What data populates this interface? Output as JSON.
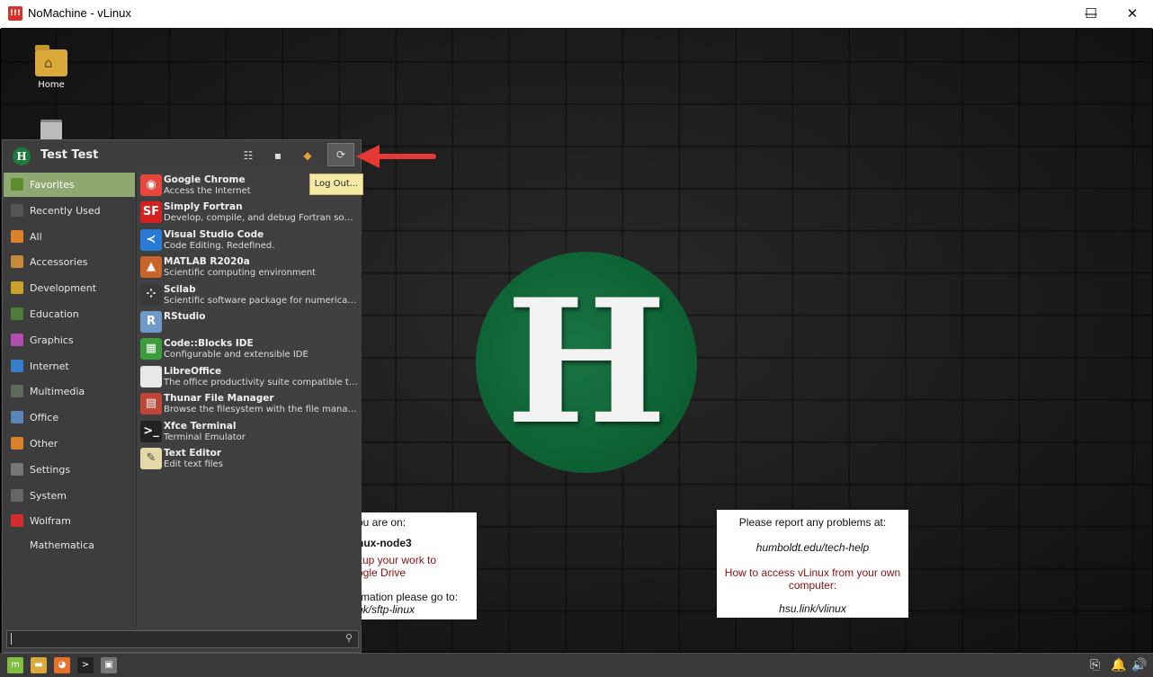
{
  "window": {
    "title": "NoMachine - vLinux",
    "minimize_glyph": "—",
    "maximize_glyph": "☐",
    "close_glyph": "✕"
  },
  "desktop": {
    "icons": [
      {
        "label": "Home",
        "icon": "home-folder-icon"
      },
      {
        "label": "",
        "icon": "trash-icon"
      }
    ],
    "logo_letter": "H",
    "left_info": {
      "line1": "ou are on:",
      "line2": "nux-node3",
      "line3": "kup your work to",
      "line4": "ogle Drive",
      "line5": "rmation please go to:",
      "line6": "nk/sftp-linux"
    },
    "right_info": {
      "line1": "Please report any problems at:",
      "line2": "humboldt.edu/tech-help",
      "line3": "How to access vLinux from your own",
      "line4": "computer:",
      "line5": "hsu.link/vlinux"
    }
  },
  "menu": {
    "user_name": "Test Test",
    "header_buttons": [
      {
        "icon": "settings-manager-icon",
        "glyph": "☷"
      },
      {
        "icon": "lock-screen-icon",
        "glyph": "▪"
      },
      {
        "icon": "switch-user-icon",
        "glyph": "◆"
      },
      {
        "icon": "logout-icon",
        "glyph": "⟳"
      }
    ],
    "tooltip": "Log Out...",
    "categories": [
      {
        "label": "Favorites",
        "icon": "favorites-icon",
        "color": "#5d8c2f",
        "active": true
      },
      {
        "label": "Recently Used",
        "icon": "recent-icon",
        "color": "#555555",
        "active": false
      },
      {
        "label": "All",
        "icon": "all-apps-icon",
        "color": "#d9822b",
        "active": false
      },
      {
        "label": "Accessories",
        "icon": "accessories-icon",
        "color": "#c58a3a",
        "active": false
      },
      {
        "label": "Development",
        "icon": "development-icon",
        "color": "#c9a227",
        "active": false
      },
      {
        "label": "Education",
        "icon": "education-icon",
        "color": "#4e7a3c",
        "active": false
      },
      {
        "label": "Graphics",
        "icon": "graphics-icon",
        "color": "#b04fb0",
        "active": false
      },
      {
        "label": "Internet",
        "icon": "internet-icon",
        "color": "#3a7ec9",
        "active": false
      },
      {
        "label": "Multimedia",
        "icon": "multimedia-icon",
        "color": "#5f6b5a",
        "active": false
      },
      {
        "label": "Office",
        "icon": "office-icon",
        "color": "#5a86b8",
        "active": false
      },
      {
        "label": "Other",
        "icon": "other-icon",
        "color": "#d9822b",
        "active": false
      },
      {
        "label": "Settings",
        "icon": "settings-icon",
        "color": "#777777",
        "active": false
      },
      {
        "label": "System",
        "icon": "system-icon",
        "color": "#666666",
        "active": false
      },
      {
        "label": "Wolfram Mathematica",
        "icon": "mathematica-icon",
        "color": "#d22c2c",
        "active": false
      }
    ],
    "apps": [
      {
        "name": "Google Chrome",
        "desc": "Access the Internet",
        "icon": "chrome-icon",
        "color": "#e8453c",
        "glyph": "◉"
      },
      {
        "name": "Simply Fortran",
        "desc": "Develop, compile, and debug Fortran sour...",
        "icon": "simply-fortran-icon",
        "color": "#d62020",
        "glyph": "SF"
      },
      {
        "name": "Visual Studio Code",
        "desc": "Code Editing. Redefined.",
        "icon": "vscode-icon",
        "color": "#2a7bd6",
        "glyph": "≺"
      },
      {
        "name": "MATLAB R2020a",
        "desc": "Scientific computing environment",
        "icon": "matlab-icon",
        "color": "#c9652a",
        "glyph": "▲"
      },
      {
        "name": "Scilab",
        "desc": "Scientific software package for numerical c...",
        "icon": "scilab-icon",
        "color": "#3a3a3a",
        "glyph": "⁘"
      },
      {
        "name": "RStudio",
        "desc": "",
        "icon": "rstudio-icon",
        "color": "#6f9ac8",
        "glyph": "R"
      },
      {
        "name": "Code::Blocks IDE",
        "desc": "Configurable and extensible IDE",
        "icon": "codeblocks-icon",
        "color": "#3d9a3d",
        "glyph": "▦"
      },
      {
        "name": "LibreOffice",
        "desc": "The office productivity suite compatible to...",
        "icon": "libreoffice-icon",
        "color": "#e8e8e8",
        "glyph": ""
      },
      {
        "name": "Thunar File Manager",
        "desc": "Browse the filesystem with the file manager",
        "icon": "thunar-icon",
        "color": "#c0463a",
        "glyph": "▤"
      },
      {
        "name": "Xfce Terminal",
        "desc": "Terminal Emulator",
        "icon": "terminal-icon",
        "color": "#222222",
        "glyph": ">_"
      },
      {
        "name": "Text Editor",
        "desc": "Edit text files",
        "icon": "text-editor-icon",
        "color": "#e6d9a8",
        "glyph": "✎"
      }
    ],
    "search_placeholder": "",
    "search_icon_glyph": "⚲"
  },
  "taskbar": {
    "launchers": [
      {
        "icon": "mint-menu-icon",
        "glyph": "m",
        "color": "#7fbf3f"
      },
      {
        "icon": "files-icon",
        "glyph": "▬",
        "color": "#d9a93a"
      },
      {
        "icon": "firefox-icon",
        "glyph": "◕",
        "color": "#e8702a"
      },
      {
        "icon": "terminal-launcher-icon",
        "glyph": ">",
        "color": "#222222"
      },
      {
        "icon": "window-list-icon",
        "glyph": "▣",
        "color": "#777777"
      }
    ],
    "tray": [
      {
        "icon": "clipboard-icon",
        "glyph": "⎘"
      },
      {
        "icon": "notification-bell-icon",
        "glyph": "🔔"
      },
      {
        "icon": "volume-icon",
        "glyph": "🔊"
      }
    ]
  },
  "colors": {
    "menu_bg": "#3d3d3d",
    "active_category": "#8fa872",
    "logo_green": "#0e6334",
    "annotation_arrow": "#e53935"
  }
}
